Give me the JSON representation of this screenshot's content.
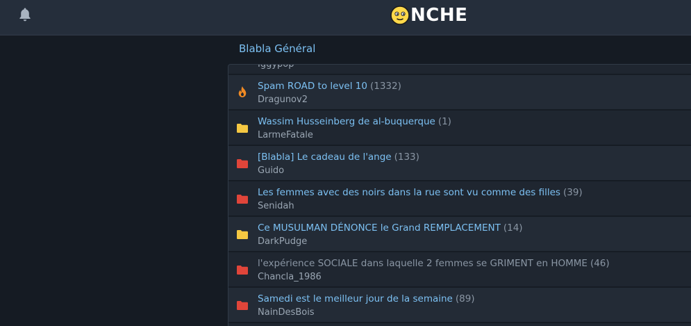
{
  "header": {
    "logo_text": "NCHE",
    "bell_icon": "bell-icon",
    "colors": {
      "bar": "#252e3b",
      "accent": "#ffd84a"
    }
  },
  "forum": {
    "title": "Blabla Général"
  },
  "topics": [
    {
      "title": "",
      "count": "(...)",
      "author": "Iggypop",
      "icon": "folder-yellow",
      "visited": false
    },
    {
      "title": "Spam ROAD to level 10",
      "count": "(1332)",
      "author": "Dragunov2",
      "icon": "fire",
      "visited": false
    },
    {
      "title": "Wassim Husseinberg de al-buquerque",
      "count": "(1)",
      "author": "LarmeFatale",
      "icon": "folder-yellow",
      "visited": false
    },
    {
      "title": "[Blabla] Le cadeau de l'ange",
      "count": "(133)",
      "author": "Guido",
      "icon": "folder-red",
      "visited": false
    },
    {
      "title": "Les femmes avec des noirs dans la rue sont vu comme des filles",
      "count": "(39)",
      "author": "Senidah",
      "icon": "folder-red",
      "visited": false
    },
    {
      "title": "Ce MUSULMAN DÉNONCE le Grand REMPLACEMENT",
      "count": "(14)",
      "author": "DarkPudge",
      "icon": "folder-yellow",
      "visited": false
    },
    {
      "title": "l'expérience SOCIALE dans laquelle 2 femmes se GRIMENT en HOMME",
      "count": "(46)",
      "author": "Chancla_1986",
      "icon": "folder-red",
      "visited": true
    },
    {
      "title": "Samedi est le meilleur jour de la semaine",
      "count": "(89)",
      "author": "NainDesBois",
      "icon": "folder-red",
      "visited": false
    }
  ],
  "colors": {
    "link": "#7cc0f2",
    "visited_link": "#8a96a4",
    "folder_yellow": "#f5c842",
    "folder_red": "#e0453a",
    "fire": "#f08a24"
  }
}
